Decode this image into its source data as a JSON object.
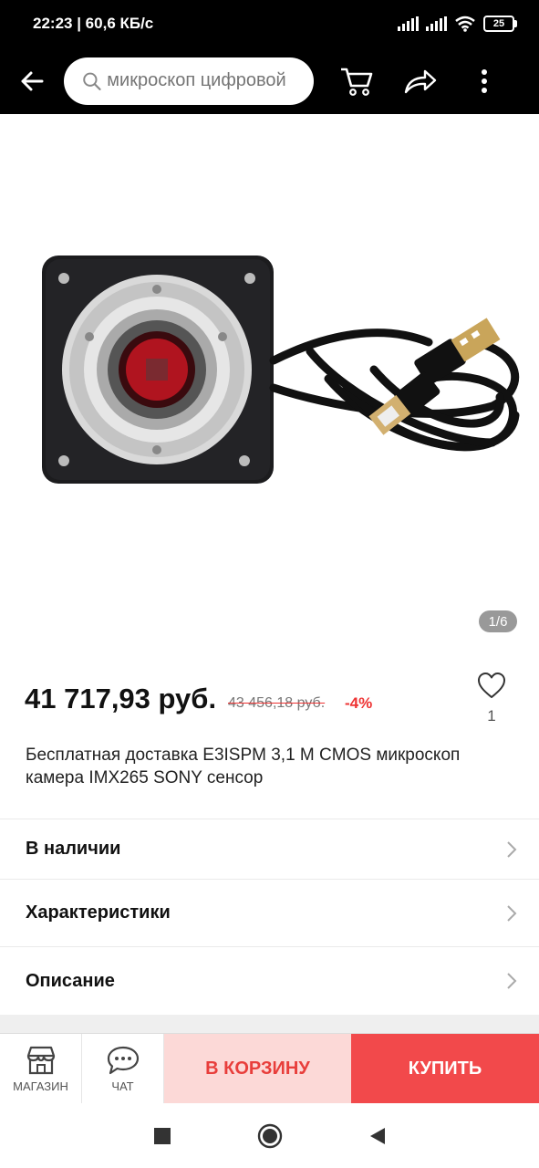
{
  "status": {
    "time_speed": "22:23 | 60,6 КБ/с",
    "battery": "25"
  },
  "header": {
    "search_placeholder": "микроскоп цифровой"
  },
  "gallery": {
    "counter": "1/6"
  },
  "product": {
    "price": "41 717,93 руб.",
    "old_price": "43 456,18 руб.",
    "discount": "-4%",
    "favorites_count": "1",
    "title": "Бесплатная доставка E3ISPM 3,1 M CMOS микроскоп камера IMX265 SONY сенсор"
  },
  "sections": {
    "availability": "В наличии",
    "specs": "Характеристики",
    "description": "Описание"
  },
  "bottom": {
    "store_label": "МАГАЗИН",
    "chat_label": "ЧАТ",
    "cart_label": "В КОРЗИНУ",
    "buy_label": "КУПИТЬ"
  },
  "colors": {
    "accent": "#f2494b",
    "accent_light": "#fcd9d7"
  },
  "icons": [
    "back-arrow-icon",
    "search-icon",
    "cart-icon",
    "share-icon",
    "more-icon",
    "heart-icon",
    "store-icon",
    "chat-icon",
    "chevron-right-icon",
    "nav-square-icon",
    "nav-home-icon",
    "nav-back-icon"
  ]
}
